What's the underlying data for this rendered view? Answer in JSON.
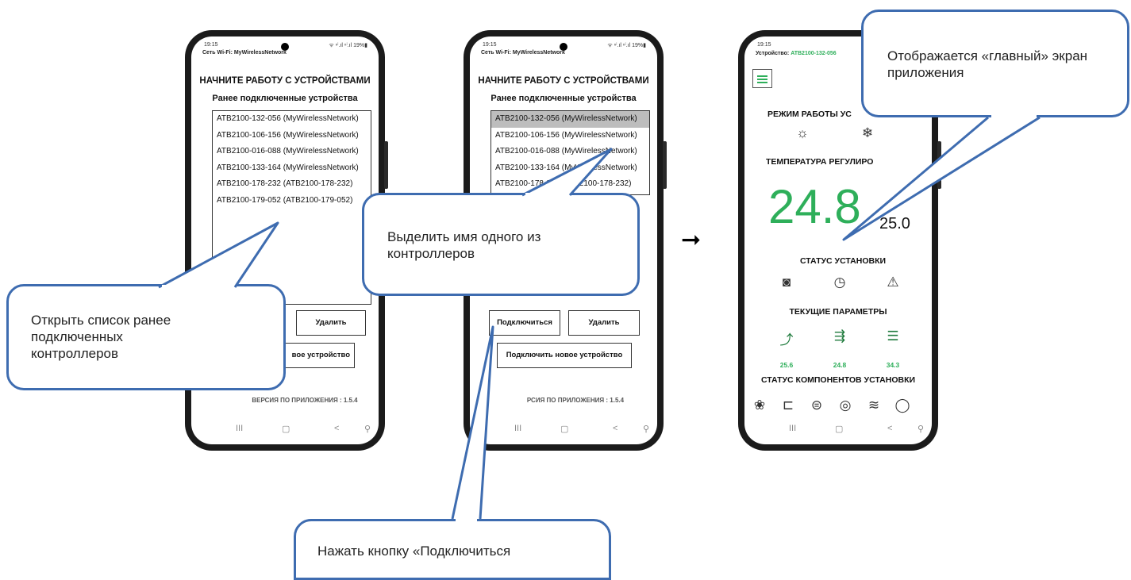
{
  "phone1": {
    "status_time": "19:15 ",
    "status_right": "ᯤ ⁿⁱ.ıl ⁿⁱ.ıl 19%▮",
    "wifi_label": "Сеть Wi-Fi: MyWirelessNetwork",
    "title": "НАЧНИТЕ РАБОТУ С УСТРОЙСТВАМИ",
    "subtitle": "Ранее подключенные устройства",
    "devices": [
      "ATB2100-132-056 (MyWirelessNetwork)",
      "ATB2100-106-156 (MyWirelessNetwork)",
      "ATB2100-016-088 (MyWirelessNetwork)",
      "ATB2100-133-164 (MyWirelessNetwork)",
      "ATB2100-178-232 (ATB2100-178-232)",
      "ATB2100-179-052 (ATB2100-179-052)"
    ],
    "delete_label": "Удалить",
    "new_device_label": "вое устройство",
    "version": "ВЕРСИЯ ПО ПРИЛОЖЕНИЯ : 1.5.4",
    "nav": [
      "III",
      "▢",
      "<",
      "⚲"
    ]
  },
  "phone2": {
    "status_time": "19:15 ",
    "status_right": "ᯤ ⁿⁱ.ıl ⁿⁱ.ıl 19%▮",
    "wifi_label": "Сеть Wi-Fi: MyWirelessNetwork",
    "title": "НАЧНИТЕ РАБОТУ С УСТРОЙСТВАМИ",
    "subtitle": "Ранее подключенные устройства",
    "devices": [
      "ATB2100-132-056 (MyWirelessNetwork)",
      "ATB2100-106-156 (MyWirelessNetwork)",
      "ATB2100-016-088 (MyWirelessNetwork)",
      "ATB2100-133-164 (MyWirelessNetwork)",
      "ATB2100-178-232 (ATB2100-178-232)"
    ],
    "connect_label": "Подключиться",
    "delete_label": "Удалить",
    "new_device_label": "Подключить новое устройство",
    "version": "РСИЯ ПО ПРИЛОЖЕНИЯ : 1.5.4",
    "nav": [
      "III",
      "▢",
      "<",
      "⚲"
    ]
  },
  "arrow": "➞",
  "phone3": {
    "status_time": "19:15 ",
    "device_prefix": "Устройство: ",
    "device_id": "ATB2100-132-056",
    "mode_header": "РЕЖИМ РАБОТЫ УС",
    "mode_icons": [
      "sun-heating-icon",
      "snowflake-cooling-icon"
    ],
    "mode_glyphs": [
      "☼",
      "❄"
    ],
    "temp_header": "ТЕМПЕРАТУРА РЕГУЛИРО",
    "current_temp": "24.8",
    "setpoint": "25.0",
    "install_status_header": "СТАТУС УСТАНОВКИ",
    "status_glyphs": [
      "◙",
      "◷",
      "⚠"
    ],
    "params_header": "ТЕКУЩИЕ ПАРАМЕТРЫ",
    "param_glyphs": [
      "⤴",
      "⇶",
      "☰"
    ],
    "params": [
      "25.6",
      "24.8",
      "34.3"
    ],
    "components_header": "СТАТУС КОМПОНЕНТОВ УСТАНОВКИ",
    "component_glyphs": [
      "❀",
      "⊏",
      "⊜",
      "◎",
      "≋",
      "◯"
    ],
    "nav": [
      "III",
      "▢",
      "<",
      "⚲"
    ]
  },
  "callouts": {
    "open_list": "Открыть список ранее подключенных контроллеров",
    "select_name": "Выделить имя одного из контроллеров",
    "press_connect": "Нажать кнопку «Подключиться",
    "main_screen": "Отображается «главный» экран приложения"
  },
  "colors": {
    "accent_green": "#2eaf5a",
    "callout_border": "#3e6cb0"
  }
}
